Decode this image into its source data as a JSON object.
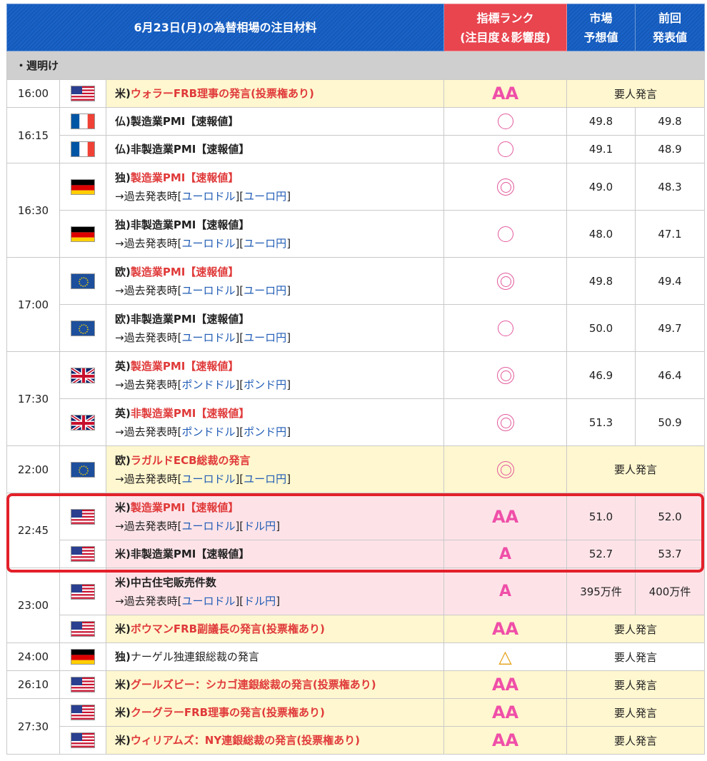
{
  "header": {
    "title": "6月23日(月)の為替相場の注目材料",
    "rank_line1": "指標ランク",
    "rank_line2": "(注目度＆影響度)",
    "forecast_line1": "市場",
    "forecast_line2": "予想値",
    "previous_line1": "前回",
    "previous_line2": "発表値"
  },
  "section": {
    "label": "・週明け"
  },
  "colors": {
    "header_blue": "#1a63c7",
    "rank_red": "#e8454f",
    "highlight_yellow": "#fff7cf",
    "highlight_pink": "#fde3e8",
    "link_blue": "#1f5bb5",
    "rank_pink": "#ef4fa8",
    "box_red": "#e3202a"
  },
  "rows": [
    {
      "time": "16:00",
      "flag": "us-flag-icon",
      "prefix": "米)",
      "title": "ウォラーFRB理事の発言(投票権あり)",
      "rank": "AA",
      "forecast": "",
      "previous": "",
      "note": "要人発言"
    },
    {
      "time": "16:15",
      "flag": "fr-flag-icon",
      "prefix": "仏)",
      "title": "製造業PMI【速報値】",
      "rank": "○",
      "forecast": "49.8",
      "previous": "49.8"
    },
    {
      "flag": "fr-flag-icon",
      "prefix": "仏)",
      "title": "非製造業PMI【速報値】",
      "rank": "○",
      "forecast": "49.1",
      "previous": "48.9"
    },
    {
      "time": "16:30",
      "flag": "de-flag-icon",
      "prefix": "独)",
      "title": "製造業PMI【速報値】",
      "arrow": "→過去発表時",
      "links": [
        "ユーロドル",
        "ユーロ円"
      ],
      "rank": "◎",
      "forecast": "49.0",
      "previous": "48.3"
    },
    {
      "flag": "de-flag-icon",
      "prefix": "独)",
      "title": "非製造業PMI【速報値】",
      "arrow": "→過去発表時",
      "links": [
        "ユーロドル",
        "ユーロ円"
      ],
      "rank": "○",
      "forecast": "48.0",
      "previous": "47.1"
    },
    {
      "time": "17:00",
      "flag": "eu-flag-icon",
      "prefix": "欧)",
      "title": "製造業PMI【速報値】",
      "arrow": "→過去発表時",
      "links": [
        "ユーロドル",
        "ユーロ円"
      ],
      "rank": "◎",
      "forecast": "49.8",
      "previous": "49.4"
    },
    {
      "flag": "eu-flag-icon",
      "prefix": "欧)",
      "title": "非製造業PMI【速報値】",
      "arrow": "→過去発表時",
      "links": [
        "ユーロドル",
        "ユーロ円"
      ],
      "rank": "○",
      "forecast": "50.0",
      "previous": "49.7"
    },
    {
      "time": "17:30",
      "flag": "uk-flag-icon",
      "prefix": "英)",
      "title": "製造業PMI【速報値】",
      "arrow": "→過去発表時",
      "links": [
        "ポンドドル",
        "ポンド円"
      ],
      "rank": "◎",
      "forecast": "46.9",
      "previous": "46.4"
    },
    {
      "flag": "uk-flag-icon",
      "prefix": "英)",
      "title": "非製造業PMI【速報値】",
      "arrow": "→過去発表時",
      "links": [
        "ポンドドル",
        "ポンド円"
      ],
      "rank": "◎",
      "forecast": "51.3",
      "previous": "50.9"
    },
    {
      "time": "22:00",
      "flag": "eu-flag-icon",
      "prefix": "欧)",
      "title": "ラガルドECB総裁の発言",
      "arrow": "→過去発表時",
      "links": [
        "ユーロドル",
        "ユーロ円"
      ],
      "rank": "◎",
      "note": "要人発言"
    },
    {
      "time": "22:45",
      "flag": "us-flag-icon",
      "prefix": "米)",
      "title": "製造業PMI【速報値】",
      "arrow": "→過去発表時",
      "links": [
        "ユーロドル",
        "ドル円"
      ],
      "rank": "AA",
      "forecast": "51.0",
      "previous": "52.0"
    },
    {
      "flag": "us-flag-icon",
      "prefix": "米)",
      "title": "非製造業PMI【速報値】",
      "rank": "A",
      "forecast": "52.7",
      "previous": "53.7"
    },
    {
      "time": "23:00",
      "flag": "us-flag-icon",
      "prefix": "米)",
      "title": "中古住宅販売件数",
      "arrow": "→過去発表時",
      "links": [
        "ユーロドル",
        "ドル円"
      ],
      "rank": "A",
      "forecast": "395万件",
      "previous": "400万件"
    },
    {
      "flag": "us-flag-icon",
      "prefix": "米)",
      "title": "ボウマンFRB副議長の発言(投票権あり)",
      "rank": "AA",
      "note": "要人発言"
    },
    {
      "time": "24:00",
      "flag": "de-flag-icon",
      "prefix": "独)",
      "title": "ナーゲル独連銀総裁の発言",
      "rank": "△",
      "note": "要人発言"
    },
    {
      "time": "26:10",
      "flag": "us-flag-icon",
      "prefix": "米)",
      "title": "グールズビー：シカゴ連銀総裁の発言(投票権あり)",
      "rank": "AA",
      "note": "要人発言"
    },
    {
      "time": "27:30",
      "flag": "us-flag-icon",
      "prefix": "米)",
      "title": "クーグラーFRB理事の発言(投票権あり)",
      "rank": "AA",
      "note": "要人発言"
    },
    {
      "flag": "us-flag-icon",
      "prefix": "米)",
      "title": "ウィリアムズ：NY連銀総裁の発言(投票権あり)",
      "rank": "AA",
      "note": "要人発言"
    }
  ]
}
